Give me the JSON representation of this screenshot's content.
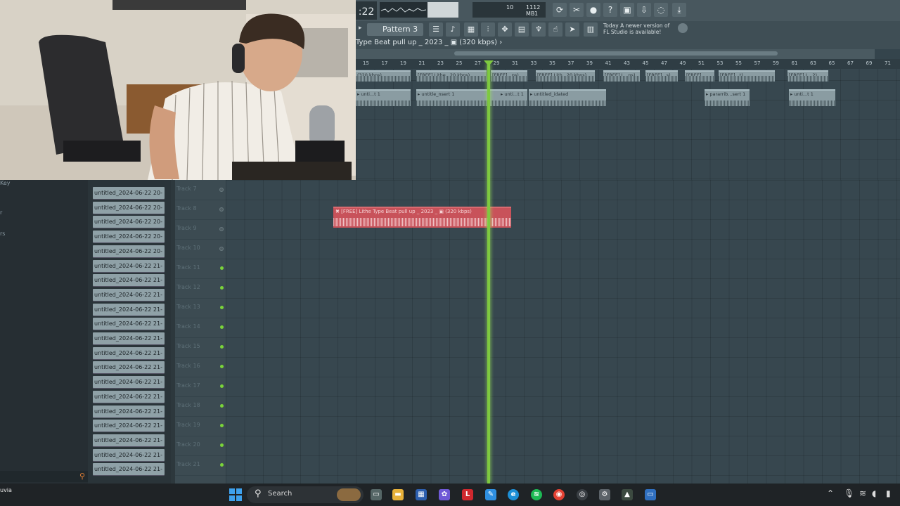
{
  "toolbar": {
    "time": ":22",
    "cpu_top": "10",
    "memory": "1112 MB",
    "cpu_bottom": "1",
    "pattern": "Pattern 3",
    "notification_line1": "Today  A newer version of",
    "notification_line2": "FL Studio is available!"
  },
  "playlist": {
    "title": "Type Beat pull up _ 2023 _ ▣ (320 kbps) ›",
    "ruler": [
      "15",
      "17",
      "19",
      "21",
      "23",
      "25",
      "27",
      "29",
      "31",
      "33",
      "35",
      "37",
      "39",
      "41",
      "43",
      "45",
      "47",
      "49",
      "51",
      "53",
      "55",
      "57",
      "59",
      "61",
      "63",
      "65",
      "67",
      "69",
      "71"
    ],
    "red_clip_label": "✖ [FREE] Lithe Type Beat pull up _ 2023 _ ▣ (320 kbps)"
  },
  "top_clips": [
    {
      "label": "(320 kbps)"
    },
    {
      "label": "[FREE] Lithe...20 kbps)"
    },
    {
      "label": "[FREE]...ps)"
    },
    {
      "label": "[FREE] Lith...20 kbps)"
    },
    {
      "label": "[FREE] L...ps)"
    },
    {
      "label": "[FREE]...s)"
    },
    {
      "label": "[FREE]..."
    },
    {
      "label": "[FREE]...t)"
    },
    {
      "label": "[FREE] L...2)"
    },
    {
      "label": "▸ unti...t 1"
    },
    {
      "label": "▸ untitle_nsert 1"
    },
    {
      "label": "▸ unti...t 1"
    },
    {
      "label": "▸ untitled_idated"
    },
    {
      "label": "▸ pararrib...sert 1"
    },
    {
      "label": "▸ unti...t 1"
    }
  ],
  "browser": {
    "partial_items": [
      "Key",
      "r",
      "rs"
    ],
    "clips": [
      "untitled_2024-06-22 20-",
      "untitled_2024-06-22 20-",
      "untitled_2024-06-22 20-",
      "untitled_2024-06-22 20-",
      "untitled_2024-06-22 20-",
      "untitled_2024-06-22 21-",
      "untitled_2024-06-22 21-",
      "untitled_2024-06-22 21-",
      "untitled_2024-06-22 21-",
      "untitled_2024-06-22 21-",
      "untitled_2024-06-22 21-",
      "untitled_2024-06-22 21-",
      "untitled_2024-06-22 21-",
      "untitled_2024-06-22 21-",
      "untitled_2024-06-22 21-",
      "untitled_2024-06-22 21-",
      "untitled_2024-06-22 21-",
      "untitled_2024-06-22 21-",
      "untitled_2024-06-22 21-",
      "untitled_2024-06-22 21-"
    ]
  },
  "tracks": [
    "Track 7",
    "Track 8",
    "Track 9",
    "Track 10",
    "Track 11",
    "Track 12",
    "Track 13",
    "Track 14",
    "Track 15",
    "Track 16",
    "Track 17",
    "Track 18",
    "Track 19",
    "Track 20",
    "Track 21"
  ],
  "taskbar": {
    "weather": "uvia",
    "search": "Search"
  },
  "colors": {
    "accent_green": "#7ec940",
    "clip_red": "#c8525a",
    "grid": "#37474f"
  }
}
